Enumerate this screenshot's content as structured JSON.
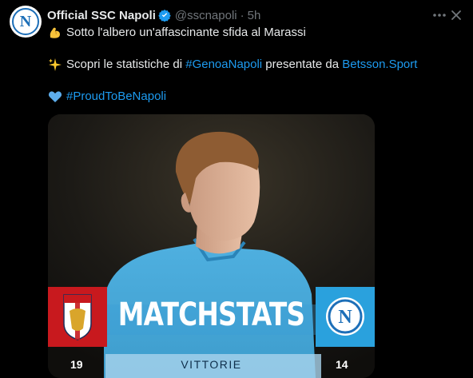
{
  "tweet": {
    "author_name": "Official SSC Napoli",
    "handle": "@sscnapoli",
    "separator": "·",
    "time": "5h",
    "line1_text": "Sotto l'albero un'affascinante sfida al Marassi",
    "line2_prefix": "Scopri le statistiche di ",
    "line2_hashtag": "#GenoaNapoli",
    "line2_middle": " presentate da ",
    "line2_link": "Betsson.Sport",
    "line3_hashtag": "#ProudToBeNapoli",
    "icons": {
      "avatar": "napoli-logo",
      "verified": "verified-badge-icon",
      "more": "more-icon",
      "close": "close-icon",
      "line1": "flexed-biceps-emoji",
      "line2": "sparkles-emoji",
      "line3": "blue-heart-emoji"
    }
  },
  "media": {
    "title": "MATCHSTATS",
    "stat_label": "VITTORIE",
    "home_value": "19",
    "away_value": "14",
    "colors": {
      "genoa_red": "#c8191e",
      "napoli_blue": "#2aa1dd",
      "shirt_blue": "#4aa8d8"
    }
  },
  "colors": {
    "background": "#000000",
    "text": "#e7e9ea",
    "muted": "#71767b",
    "link": "#1d9bf0"
  }
}
